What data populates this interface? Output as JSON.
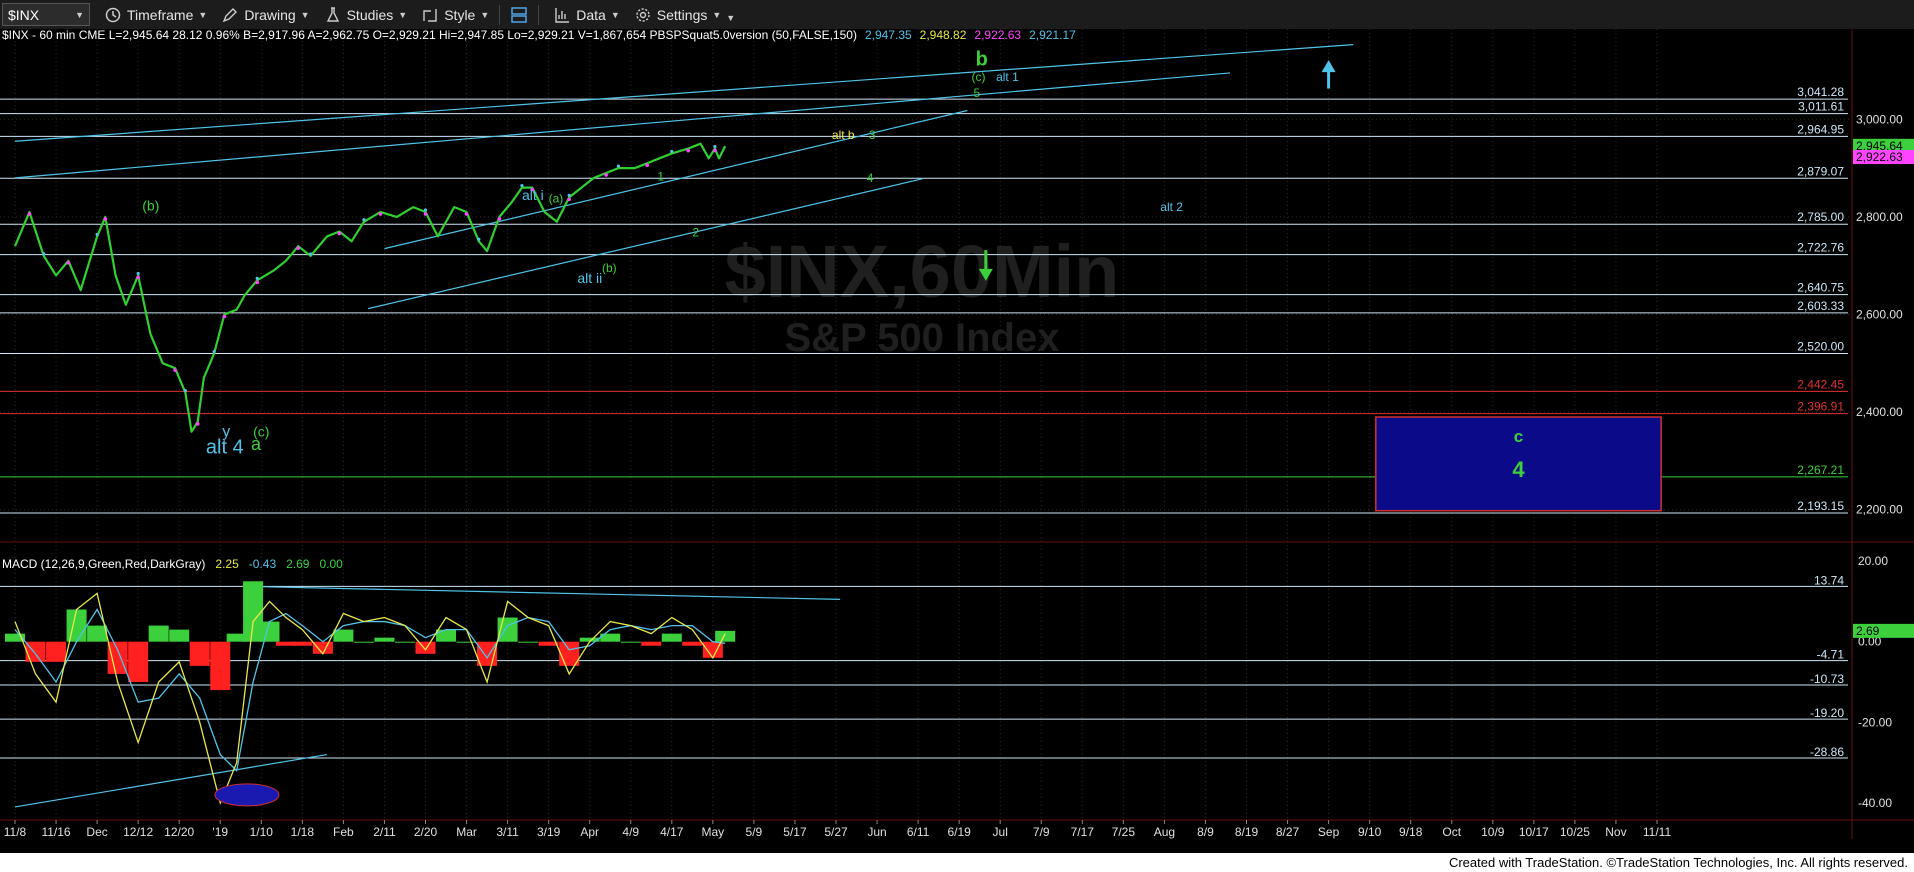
{
  "toolbar": {
    "symbol": "$INX",
    "timeframe": "Timeframe",
    "drawing": "Drawing",
    "studies": "Studies",
    "style": "Style",
    "data": "Data",
    "settings": "Settings"
  },
  "header": {
    "parts": [
      {
        "text": "$INX - 60 min  CME  L=2,945.64  28.12  0.96%  B=2,917.96  A=2,962.75  O=2,929.21  Hi=2,947.85  Lo=2,929.21  V=1,867,654  PBSPSquat5.0version (50,FALSE,150)",
        "color": "#ffffff"
      },
      {
        "text": "2,947.35",
        "color": "#4fc3e8"
      },
      {
        "text": "2,948.82",
        "color": "#e8e84a"
      },
      {
        "text": "2,922.63",
        "color": "#ff44ff"
      },
      {
        "text": "2,921.17",
        "color": "#4fc3e8"
      }
    ]
  },
  "watermark": {
    "symbol": "$INX,60Min",
    "name": "S&P 500 Index"
  },
  "footer": {
    "text": "Created with TradeStation. ©TradeStation Technologies, Inc. All rights reserved."
  },
  "chart_data": [
    {
      "type": "line",
      "title": "$INX - 60 min",
      "ylim": [
        2140,
        3185
      ],
      "y_ticks": [
        2200,
        2400,
        2600,
        2800,
        3000
      ],
      "y_tick_labels": [
        "2,200.00",
        "2,400.00",
        "2,600.00",
        "2,800.00",
        "3,000.00"
      ],
      "x_tick_labels": [
        "11/8",
        "11/16",
        "Dec",
        "12/12",
        "12/20",
        "'19",
        "1/10",
        "1/18",
        "Feb",
        "2/11",
        "2/20",
        "Mar",
        "3/11",
        "3/19",
        "Apr",
        "4/9",
        "4/17",
        "May",
        "5/9",
        "5/17",
        "5/27",
        "Jun",
        "6/11",
        "6/19",
        "Jul",
        "7/9",
        "7/17",
        "7/25",
        "Aug",
        "8/9",
        "8/19",
        "8/27",
        "Sep",
        "9/10",
        "9/18",
        "Oct",
        "10/9",
        "10/17",
        "10/25",
        "Nov",
        "11/11"
      ],
      "x_tick_index": [
        0,
        1,
        2,
        3,
        4,
        5,
        6,
        7,
        8,
        9,
        10,
        11,
        12,
        13,
        14,
        15,
        16,
        17,
        18,
        19,
        20,
        21,
        22,
        23,
        24,
        25,
        26,
        27,
        28,
        29,
        30,
        31,
        32,
        33,
        34,
        35,
        36,
        37,
        38,
        39,
        40
      ],
      "series": [
        {
          "x": [
            0,
            0.35,
            0.7,
            1.0,
            1.3,
            1.6,
            2.0,
            2.2,
            2.45,
            2.7,
            3.0,
            3.3,
            3.6,
            3.9,
            4.15,
            4.3,
            4.45,
            4.6,
            4.85,
            5.1,
            5.4,
            5.6,
            5.9,
            6.3,
            6.6,
            6.9,
            7.2,
            7.6,
            7.9,
            8.2,
            8.5,
            8.9,
            9.3,
            9.7,
            10.0,
            10.3,
            10.7,
            11.0,
            11.3,
            11.5,
            11.8,
            12.1,
            12.35,
            12.6,
            12.9,
            13.2,
            13.5,
            13.8,
            14.1,
            14.4,
            14.7,
            15.1,
            15.4,
            15.7,
            16.0,
            16.4,
            16.7,
            16.9,
            17.05,
            17.15,
            17.3
          ],
          "y": [
            2740,
            2810,
            2720,
            2680,
            2710,
            2650,
            2760,
            2800,
            2680,
            2620,
            2680,
            2560,
            2500,
            2490,
            2440,
            2360,
            2380,
            2470,
            2520,
            2600,
            2610,
            2640,
            2670,
            2690,
            2710,
            2740,
            2720,
            2760,
            2770,
            2750,
            2790,
            2810,
            2800,
            2820,
            2810,
            2760,
            2820,
            2810,
            2750,
            2730,
            2800,
            2830,
            2860,
            2860,
            2810,
            2790,
            2840,
            2860,
            2880,
            2890,
            2900,
            2900,
            2910,
            2920,
            2930,
            2940,
            2950,
            2920,
            2940,
            2920,
            2945
          ]
        }
      ],
      "price_levels": [
        {
          "value": 3041.28,
          "label": "3,041.28",
          "color": "#cfe7f7"
        },
        {
          "value": 3011.61,
          "label": "3,011.61",
          "color": "#cfe7f7"
        },
        {
          "value": 2964.95,
          "label": "2,964.95",
          "color": "#cfe7f7"
        },
        {
          "value": 2879.07,
          "label": "2,879.07",
          "color": "#cfe7f7"
        },
        {
          "value": 2785.0,
          "label": "2,785.00",
          "color": "#cfe7f7"
        },
        {
          "value": 2722.76,
          "label": "2,722.76",
          "color": "#cfe7f7"
        },
        {
          "value": 2640.75,
          "label": "2,640.75",
          "color": "#cfe7f7"
        },
        {
          "value": 2603.33,
          "label": "2,603.33",
          "color": "#cfe7f7"
        },
        {
          "value": 2520.0,
          "label": "2,520.00",
          "color": "#cfe7f7"
        },
        {
          "value": 2442.45,
          "label": "2,442.45",
          "color": "#e03030"
        },
        {
          "value": 2396.91,
          "label": "2,396.91",
          "color": "#e03030"
        },
        {
          "value": 2267.21,
          "label": "2,267.21",
          "color": "#3cd03c"
        },
        {
          "value": 2193.15,
          "label": "2,193.15",
          "color": "#cfe7f7"
        }
      ],
      "last_price_tags": [
        {
          "value": 2945.64,
          "label": "2,945.64",
          "bg": "#3cd03c"
        },
        {
          "value": 2922.63,
          "label": "2,922.63",
          "bg": "#ff44ff"
        }
      ],
      "trendlines": [
        {
          "x": [
            0,
            32.6
          ],
          "y": [
            2955,
            3153
          ],
          "color": "#4fc3e8"
        },
        {
          "x": [
            0,
            29.6
          ],
          "y": [
            2880,
            3095
          ],
          "color": "#4fc3e8"
        },
        {
          "x": [
            9.0,
            23.2
          ],
          "y": [
            2735,
            3018
          ],
          "color": "#4fc3e8"
        },
        {
          "x": [
            8.6,
            22.1
          ],
          "y": [
            2612,
            2878
          ],
          "color": "#4fc3e8"
        }
      ],
      "target_box": {
        "x": [
          33.15,
          40.1
        ],
        "y": [
          2198,
          2390
        ],
        "fill": "#0b0b8a",
        "border": "#d03030",
        "labels": [
          {
            "text": "c",
            "color": "#3cd03c"
          },
          {
            "text": "4",
            "color": "#3cd03c"
          }
        ]
      },
      "arrows": [
        {
          "x": 32.0,
          "y_tail": 3063,
          "y_head": 3115,
          "color": "#4fc3e8"
        },
        {
          "x": 23.65,
          "y_tail": 2732,
          "y_head": 2675,
          "color": "#3cd03c"
        }
      ],
      "annotations": [
        {
          "text": "b",
          "x": 23.4,
          "y": 3110,
          "color": "#3cd03c",
          "size": 20,
          "bold": true
        },
        {
          "text": "(c)",
          "x": 23.3,
          "y": 3078,
          "color": "#3cd03c",
          "size": 12
        },
        {
          "text": "alt 1",
          "x": 23.9,
          "y": 3078,
          "color": "#4fc3e8",
          "size": 12
        },
        {
          "text": "5",
          "x": 23.35,
          "y": 3046,
          "color": "#3cd03c",
          "size": 12
        },
        {
          "text": "alt b",
          "x": 19.9,
          "y": 2960,
          "color": "#e8e84a",
          "size": 12
        },
        {
          "text": "3",
          "x": 20.8,
          "y": 2960,
          "color": "#3cd03c",
          "size": 12
        },
        {
          "text": "4",
          "x": 20.75,
          "y": 2872,
          "color": "#3cd03c",
          "size": 12
        },
        {
          "text": "alt i",
          "x": 12.35,
          "y": 2835,
          "color": "#4fc3e8",
          "size": 14
        },
        {
          "text": "(a)",
          "x": 13.0,
          "y": 2830,
          "color": "#3cd03c",
          "size": 12
        },
        {
          "text": "1",
          "x": 15.65,
          "y": 2875,
          "color": "#3cd03c",
          "size": 12
        },
        {
          "text": "2",
          "x": 16.5,
          "y": 2760,
          "color": "#3cd03c",
          "size": 12
        },
        {
          "text": "(b)",
          "x": 14.3,
          "y": 2687,
          "color": "#3cd03c",
          "size": 12
        },
        {
          "text": "alt ii",
          "x": 13.7,
          "y": 2665,
          "color": "#4fc3e8",
          "size": 14
        },
        {
          "text": "(b)",
          "x": 3.1,
          "y": 2813,
          "color": "#3cd03c",
          "size": 14
        },
        {
          "text": "alt 2",
          "x": 27.9,
          "y": 2812,
          "color": "#4fc3e8",
          "size": 12
        },
        {
          "text": "y",
          "x": 5.05,
          "y": 2350,
          "color": "#4fc3e8",
          "size": 16
        },
        {
          "text": "alt 4",
          "x": 4.65,
          "y": 2315,
          "color": "#4fc3e8",
          "size": 20
        },
        {
          "text": "(c)",
          "x": 5.8,
          "y": 2350,
          "color": "#3cd03c",
          "size": 14
        },
        {
          "text": "a",
          "x": 5.75,
          "y": 2322,
          "color": "#3cd03c",
          "size": 18
        }
      ]
    },
    {
      "type": "line",
      "title": "MACD (12,26,9,Green,Red,DarkGray)",
      "ylim": [
        -44,
        24
      ],
      "y_ticks": [
        20,
        0,
        -20,
        -40
      ],
      "y_tick_labels": [
        "20.00",
        "0.00",
        "-20.00",
        "-40.00"
      ],
      "legend_values": [
        {
          "text": "2.25",
          "color": "#e8e84a"
        },
        {
          "text": "-0.43",
          "color": "#4fc3e8"
        },
        {
          "text": "2.69",
          "color": "#3cd03c"
        },
        {
          "text": "0.00",
          "color": "#3cd03c"
        }
      ],
      "levels": [
        {
          "value": 13.74,
          "label": "13.74"
        },
        {
          "value": -4.71,
          "label": "-4.71"
        },
        {
          "value": -10.73,
          "label": "-10.73"
        },
        {
          "value": -19.2,
          "label": "-19.20"
        },
        {
          "value": -28.86,
          "label": "-28.86"
        }
      ],
      "last_value_tag": {
        "value": 2.69,
        "label": "2.69",
        "bg": "#3cd03c"
      },
      "series": [
        {
          "name": "MACD",
          "color": "#e8e84a",
          "x": [
            0,
            0.5,
            1.0,
            1.5,
            2.0,
            2.5,
            3.0,
            3.5,
            4.0,
            4.5,
            5.0,
            5.4,
            5.8,
            6.2,
            6.6,
            7.0,
            7.5,
            8.0,
            8.5,
            9.0,
            9.5,
            10.0,
            10.5,
            11.0,
            11.5,
            12.0,
            12.5,
            13.0,
            13.5,
            14.0,
            14.5,
            15.0,
            15.5,
            16.0,
            16.5,
            17.0,
            17.3
          ],
          "y": [
            5,
            -8,
            -15,
            8,
            12,
            -10,
            -25,
            -10,
            -5,
            -20,
            -40,
            -30,
            5,
            10,
            6,
            3,
            -3,
            7,
            5,
            6,
            4,
            -2,
            6,
            3,
            -10,
            10,
            6,
            4,
            -8,
            0,
            5,
            4,
            2,
            6,
            3,
            -4,
            2
          ]
        },
        {
          "name": "Signal",
          "color": "#4fc3e8",
          "x": [
            0,
            0.5,
            1.0,
            1.5,
            2.0,
            2.5,
            3.0,
            3.5,
            4.0,
            4.5,
            5.0,
            5.4,
            5.8,
            6.2,
            6.6,
            7.0,
            7.5,
            8.0,
            8.5,
            9.0,
            9.5,
            10.0,
            10.5,
            11.0,
            11.5,
            12.0,
            12.5,
            13.0,
            13.5,
            14.0,
            14.5,
            15.0,
            15.5,
            16.0,
            16.5,
            17.0,
            17.3
          ],
          "y": [
            3,
            -3,
            -10,
            0,
            8,
            -2,
            -15,
            -14,
            -8,
            -14,
            -28,
            -32,
            -10,
            5,
            7,
            4,
            0,
            4,
            5,
            5,
            4,
            1,
            3,
            3,
            -4,
            4,
            6,
            5,
            -2,
            -1,
            3,
            4,
            3,
            4,
            4,
            0,
            -0.4
          ]
        },
        {
          "name": "Histogram",
          "color": "#3cd03c",
          "negative_color": "#ff2020",
          "style": "histogram",
          "x": [
            0,
            0.5,
            1.0,
            1.5,
            2.0,
            2.5,
            3.0,
            3.5,
            4.0,
            4.5,
            5.0,
            5.4,
            5.8,
            6.2,
            6.6,
            7.0,
            7.5,
            8.0,
            8.5,
            9.0,
            9.5,
            10.0,
            10.5,
            11.0,
            11.5,
            12.0,
            12.5,
            13.0,
            13.5,
            14.0,
            14.5,
            15.0,
            15.5,
            16.0,
            16.5,
            17.0,
            17.3
          ],
          "y": [
            2,
            -5,
            -5,
            8,
            4,
            -8,
            -10,
            4,
            3,
            -6,
            -12,
            2,
            15,
            5,
            -1,
            -1,
            -3,
            3,
            0,
            1,
            0,
            -3,
            3,
            0,
            -6,
            6,
            0,
            -1,
            -6,
            1,
            2,
            0,
            -1,
            2,
            -1,
            -4,
            2.69
          ]
        }
      ],
      "trendlines": [
        {
          "x": [
            5.6,
            20.1
          ],
          "y": [
            13.74,
            10.5
          ],
          "color": "#4fc3e8"
        },
        {
          "x": [
            0,
            7.6
          ],
          "y": [
            -41,
            -28
          ],
          "color": "#4fc3e8"
        }
      ],
      "marker": {
        "x": 5.65,
        "y": -38,
        "fill": "#1a1ab0",
        "border": "#d03030"
      }
    }
  ]
}
